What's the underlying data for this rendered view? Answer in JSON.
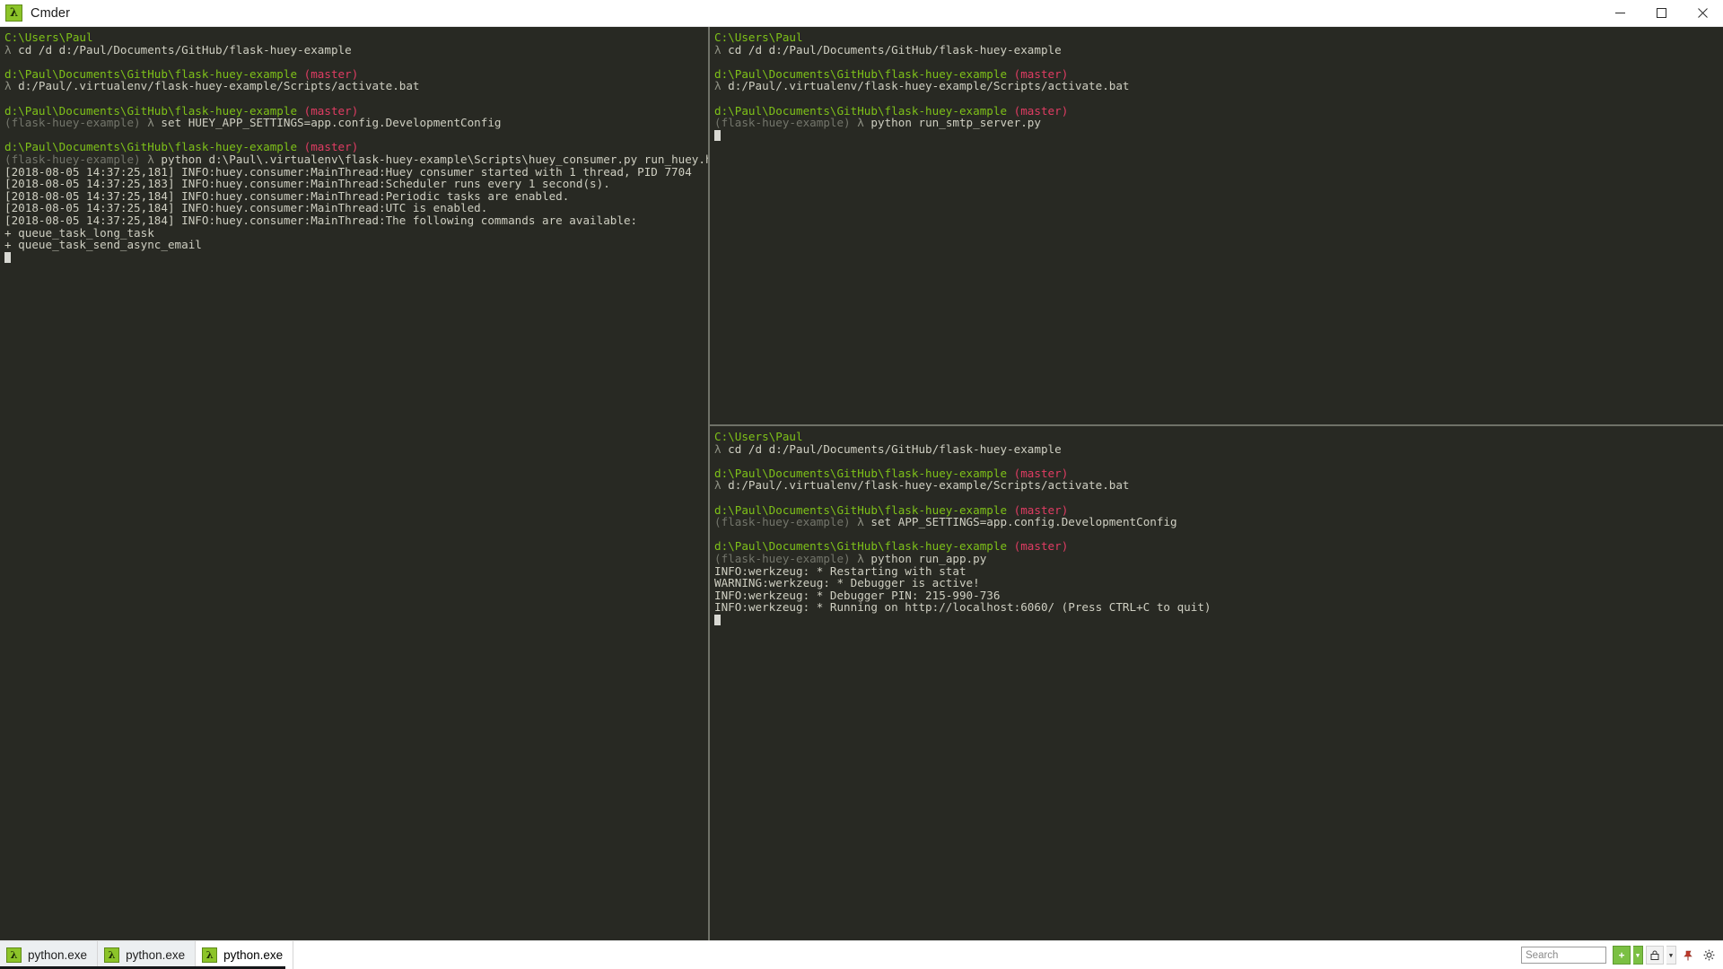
{
  "window": {
    "title": "Cmder",
    "icon": "lambda-icon",
    "minimize_label": "Minimize",
    "maximize_label": "Maximize",
    "close_label": "Close"
  },
  "theme": {
    "background": "#282923",
    "foreground": "#cfcfc2",
    "prompt_path": "#7ec119",
    "git_branch": "#e03c63",
    "lambda": "#8f9184",
    "venv": "#73756b",
    "splitter": "#6f7168",
    "accent_green": "#8cc429"
  },
  "panes": {
    "left": {
      "name": "huey-consumer-pane",
      "lines": [
        {
          "type": "prompt",
          "path": "C:\\Users\\Paul"
        },
        {
          "type": "cmd",
          "lambda": "λ",
          "text": "cd /d d:/Paul/Documents/GitHub/flask-huey-example"
        },
        {
          "type": "blank"
        },
        {
          "type": "prompt",
          "path": "d:\\Paul\\Documents\\GitHub\\flask-huey-example",
          "branch": "(master)"
        },
        {
          "type": "cmd",
          "lambda": "λ",
          "text": "d:/Paul/.virtualenv/flask-huey-example/Scripts/activate.bat"
        },
        {
          "type": "blank"
        },
        {
          "type": "prompt",
          "path": "d:\\Paul\\Documents\\GitHub\\flask-huey-example",
          "branch": "(master)"
        },
        {
          "type": "cmd",
          "venv": "(flask-huey-example)",
          "lambda": "λ",
          "text": "set HUEY_APP_SETTINGS=app.config.DevelopmentConfig"
        },
        {
          "type": "blank"
        },
        {
          "type": "prompt",
          "path": "d:\\Paul\\Documents\\GitHub\\flask-huey-example",
          "branch": "(master)"
        },
        {
          "type": "cmd",
          "venv": "(flask-huey-example)",
          "lambda": "λ",
          "text": "python d:\\Paul\\.virtualenv\\flask-huey-example\\Scripts\\huey_consumer.py run_huey.huey"
        },
        {
          "type": "out",
          "text": "[2018-08-05 14:37:25,181] INFO:huey.consumer:MainThread:Huey consumer started with 1 thread, PID 7704"
        },
        {
          "type": "out",
          "text": "[2018-08-05 14:37:25,183] INFO:huey.consumer:MainThread:Scheduler runs every 1 second(s)."
        },
        {
          "type": "out",
          "text": "[2018-08-05 14:37:25,184] INFO:huey.consumer:MainThread:Periodic tasks are enabled."
        },
        {
          "type": "out",
          "text": "[2018-08-05 14:37:25,184] INFO:huey.consumer:MainThread:UTC is enabled."
        },
        {
          "type": "out",
          "text": "[2018-08-05 14:37:25,184] INFO:huey.consumer:MainThread:The following commands are available:"
        },
        {
          "type": "out",
          "text": "+ queue_task_long_task"
        },
        {
          "type": "out",
          "text": "+ queue_task_send_async_email"
        },
        {
          "type": "cursor"
        }
      ]
    },
    "top_right": {
      "name": "smtp-server-pane",
      "lines": [
        {
          "type": "prompt",
          "path": "C:\\Users\\Paul"
        },
        {
          "type": "cmd",
          "lambda": "λ",
          "text": "cd /d d:/Paul/Documents/GitHub/flask-huey-example"
        },
        {
          "type": "blank"
        },
        {
          "type": "prompt",
          "path": "d:\\Paul\\Documents\\GitHub\\flask-huey-example",
          "branch": "(master)"
        },
        {
          "type": "cmd",
          "lambda": "λ",
          "text": "d:/Paul/.virtualenv/flask-huey-example/Scripts/activate.bat"
        },
        {
          "type": "blank"
        },
        {
          "type": "prompt",
          "path": "d:\\Paul\\Documents\\GitHub\\flask-huey-example",
          "branch": "(master)"
        },
        {
          "type": "cmd",
          "venv": "(flask-huey-example)",
          "lambda": "λ",
          "text": "python run_smtp_server.py"
        },
        {
          "type": "cursor"
        }
      ]
    },
    "bottom_right": {
      "name": "flask-app-pane",
      "lines": [
        {
          "type": "prompt",
          "path": "C:\\Users\\Paul"
        },
        {
          "type": "cmd",
          "lambda": "λ",
          "text": "cd /d d:/Paul/Documents/GitHub/flask-huey-example"
        },
        {
          "type": "blank"
        },
        {
          "type": "prompt",
          "path": "d:\\Paul\\Documents\\GitHub\\flask-huey-example",
          "branch": "(master)"
        },
        {
          "type": "cmd",
          "lambda": "λ",
          "text": "d:/Paul/.virtualenv/flask-huey-example/Scripts/activate.bat"
        },
        {
          "type": "blank"
        },
        {
          "type": "prompt",
          "path": "d:\\Paul\\Documents\\GitHub\\flask-huey-example",
          "branch": "(master)"
        },
        {
          "type": "cmd",
          "venv": "(flask-huey-example)",
          "lambda": "λ",
          "text": "set APP_SETTINGS=app.config.DevelopmentConfig"
        },
        {
          "type": "blank"
        },
        {
          "type": "prompt",
          "path": "d:\\Paul\\Documents\\GitHub\\flask-huey-example",
          "branch": "(master)"
        },
        {
          "type": "cmd",
          "venv": "(flask-huey-example)",
          "lambda": "λ",
          "text": "python run_app.py"
        },
        {
          "type": "out",
          "text": "INFO:werkzeug: * Restarting with stat"
        },
        {
          "type": "out",
          "text": "WARNING:werkzeug: * Debugger is active!"
        },
        {
          "type": "out",
          "text": "INFO:werkzeug: * Debugger PIN: 215-990-736"
        },
        {
          "type": "out",
          "text": "INFO:werkzeug: * Running on http://localhost:6060/ (Press CTRL+C to quit)"
        },
        {
          "type": "cursor"
        }
      ]
    }
  },
  "tabbar": {
    "tabs": [
      {
        "label": "python.exe",
        "icon": "lambda-icon",
        "active": false
      },
      {
        "label": "python.exe",
        "icon": "lambda-icon",
        "active": false
      },
      {
        "label": "python.exe",
        "icon": "lambda-icon",
        "active": true
      }
    ],
    "search_placeholder": "Search",
    "search_value": "",
    "buttons": [
      {
        "name": "new-console-button",
        "icon": "plus-icon",
        "label": "+"
      },
      {
        "name": "new-console-dropdown",
        "icon": "chevron-down-icon",
        "label": "▾"
      },
      {
        "name": "lock-button",
        "icon": "lock-icon",
        "label": "▾"
      },
      {
        "name": "pin-button",
        "icon": "pin-icon",
        "label": ""
      },
      {
        "name": "settings-button",
        "icon": "gear-icon",
        "label": ""
      }
    ]
  }
}
